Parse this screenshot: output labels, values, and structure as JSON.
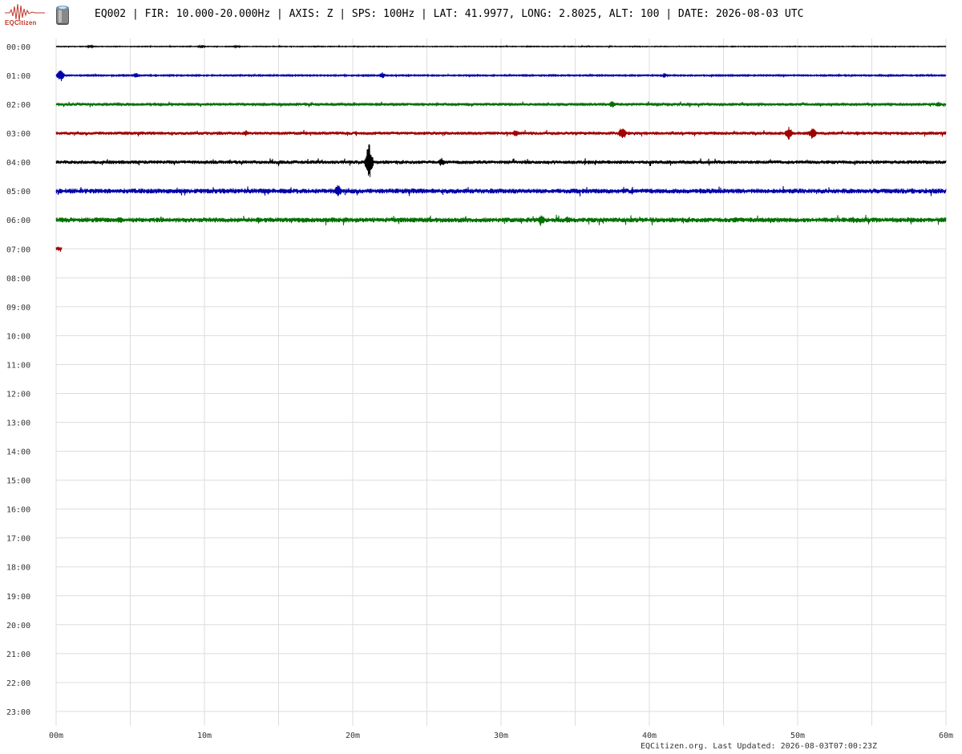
{
  "header": {
    "title": "EQ002 | FIR: 10.000-20.000Hz | AXIS: Z | SPS: 100Hz | LAT: 41.9977, LONG: 2.8025, ALT: 100 | DATE: 2026-08-03 UTC",
    "logo_text": "EQCitizen",
    "logo_icon": "seismogram-logo-icon",
    "sensor_icon": "seismometer-sensor-icon"
  },
  "footer": {
    "text": "EQCitizen.org. Last Updated: 2026-08-03T07:00:23Z"
  },
  "colors": {
    "trace_cycle": [
      "#000000",
      "#0000a8",
      "#007000",
      "#a00000"
    ],
    "grid": "#dddddd",
    "axis_text": "#333333",
    "logo": "#c0392b"
  },
  "chart_data": {
    "type": "line",
    "title": "",
    "xlabel": "",
    "ylabel": "",
    "grid": true,
    "x_ticks": [
      "00m",
      "10m",
      "20m",
      "30m",
      "40m",
      "50m",
      "60m"
    ],
    "x_minor_step_minutes": 5,
    "xlim_minutes": [
      0,
      60
    ],
    "rows": [
      "00:00",
      "01:00",
      "02:00",
      "03:00",
      "04:00",
      "05:00",
      "06:00",
      "07:00",
      "08:00",
      "09:00",
      "10:00",
      "11:00",
      "12:00",
      "13:00",
      "14:00",
      "15:00",
      "16:00",
      "17:00",
      "18:00",
      "19:00",
      "20:00",
      "21:00",
      "22:00",
      "23:00"
    ],
    "series": [
      {
        "row": "00:00",
        "color": "#000000",
        "end_minute": 60,
        "noise": 0.35,
        "events": [
          {
            "minute": 2.3,
            "amp": 2.0
          },
          {
            "minute": 9.8,
            "amp": 2.5
          },
          {
            "minute": 12.2,
            "amp": 1.8
          }
        ]
      },
      {
        "row": "01:00",
        "color": "#0000a8",
        "end_minute": 60,
        "noise": 0.6,
        "events": [
          {
            "minute": 0.3,
            "amp": 9.0
          },
          {
            "minute": 5.4,
            "amp": 4.0
          },
          {
            "minute": 22.0,
            "amp": 4.0
          },
          {
            "minute": 41.0,
            "amp": 3.0
          }
        ]
      },
      {
        "row": "02:00",
        "color": "#007000",
        "end_minute": 60,
        "noise": 1.2,
        "events": [
          {
            "minute": 37.5,
            "amp": 5.0
          },
          {
            "minute": 59.5,
            "amp": 3.5
          }
        ]
      },
      {
        "row": "03:00",
        "color": "#a00000",
        "end_minute": 60,
        "noise": 1.4,
        "events": [
          {
            "minute": 12.8,
            "amp": 4.0
          },
          {
            "minute": 31.0,
            "amp": 5.0
          },
          {
            "minute": 38.2,
            "amp": 10.0
          },
          {
            "minute": 49.4,
            "amp": 9.0
          },
          {
            "minute": 51.0,
            "amp": 9.0
          }
        ]
      },
      {
        "row": "04:00",
        "color": "#000000",
        "end_minute": 60,
        "noise": 1.6,
        "events": [
          {
            "minute": 21.1,
            "amp": 25.0
          },
          {
            "minute": 26.0,
            "amp": 6.0
          }
        ]
      },
      {
        "row": "05:00",
        "color": "#0000a8",
        "end_minute": 60,
        "noise": 2.2,
        "events": [
          {
            "minute": 19.0,
            "amp": 9.0
          },
          {
            "minute": 15.4,
            "amp": 4.0
          }
        ]
      },
      {
        "row": "06:00",
        "color": "#007000",
        "end_minute": 60,
        "noise": 2.2,
        "events": [
          {
            "minute": 4.3,
            "amp": 5.0
          },
          {
            "minute": 32.7,
            "amp": 8.0
          },
          {
            "minute": 34.5,
            "amp": 5.0
          },
          {
            "minute": 45.8,
            "amp": 4.0
          }
        ]
      },
      {
        "row": "07:00",
        "color": "#a00000",
        "end_minute": 0.4,
        "noise": 2.0,
        "events": []
      }
    ]
  }
}
